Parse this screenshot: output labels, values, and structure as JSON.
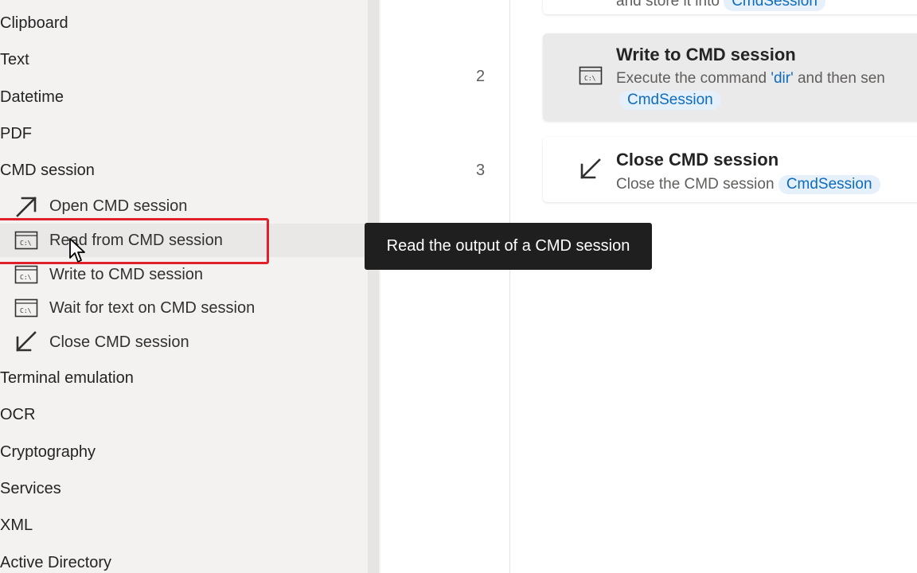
{
  "sidebar": {
    "categories_top": [
      "Clipboard",
      "Text",
      "Datetime",
      "PDF",
      "CMD session"
    ],
    "cmd_actions": [
      {
        "label": "Open CMD session",
        "icon": "open-arrow-icon"
      },
      {
        "label": "Read from CMD session",
        "icon": "cmd-console-icon"
      },
      {
        "label": "Write to CMD session",
        "icon": "cmd-console-icon"
      },
      {
        "label": "Wait for text on CMD session",
        "icon": "cmd-console-icon"
      },
      {
        "label": "Close CMD session",
        "icon": "close-arrow-icon"
      }
    ],
    "categories_bottom": [
      "Terminal emulation",
      "OCR",
      "Cryptography",
      "Services",
      "XML",
      "Active Directory"
    ]
  },
  "tooltip": {
    "text": "Read the output of a CMD session"
  },
  "flow": {
    "top_card_partial": {
      "desc": "and store it into",
      "variable": "CmdSession"
    },
    "steps": [
      {
        "number": "2",
        "title": "Write to CMD session",
        "desc_prefix": "Execute the command ",
        "desc_value": "'dir'",
        "desc_suffix": " and then sen",
        "variable": "CmdSession"
      },
      {
        "number": "3",
        "title": "Close CMD session",
        "desc_prefix": "Close the CMD session",
        "variable": "CmdSession"
      }
    ]
  },
  "colors": {
    "highlight": "#e0202a",
    "variable_chip": "#e5f0fb",
    "variable_text": "#0f6cbd",
    "tooltip_bg": "#1f1f1f"
  }
}
